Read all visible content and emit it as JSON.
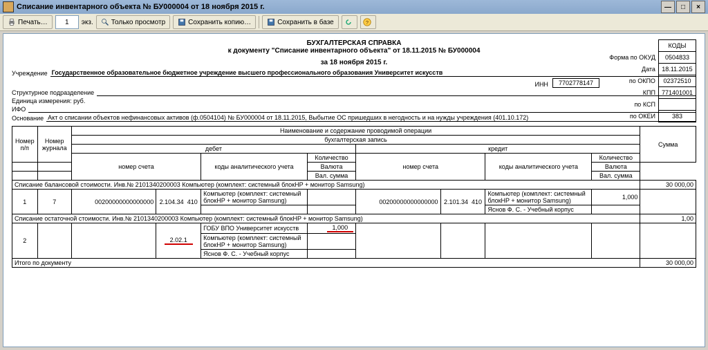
{
  "window": {
    "title": "Списание инвентарного объекта № БУ000004 от 18 ноября 2015 г."
  },
  "toolbar": {
    "print": "Печать…",
    "copies": "1",
    "copies_unit": "экз.",
    "preview": "Только просмотр",
    "save_copy": "Сохранить копию…",
    "save_db": "Сохранить в базе"
  },
  "doc": {
    "title1": "БУХГАЛТЕРСКАЯ СПРАВКА",
    "title2": "к документу \"Списание инвентарного объекта\" от 18.11.2015 № БУ000004",
    "date_line": "за 18 ноября 2015 г.",
    "org_lbl": "Учреждение",
    "org": "Государственное образовательное бюджетное учреждение высшего профессионального образования  Университет искусств",
    "inn_lbl": "ИНН",
    "inn": "7702778147",
    "struct_lbl": "Структурное подразделение",
    "unit_lbl": "Единица измерения: руб.",
    "ifo_lbl": "ИФО",
    "basis_lbl": "Основание",
    "basis": "Акт о списании объектов нефинансовых активов (ф.0504104) № БУ000004 от 18.11.2015, Выбытие ОС пришедших в негодность и на нужды учреждения (401.10.172)"
  },
  "codes": {
    "hdr": "КОДЫ",
    "okud_lbl": "Форма  по ОКУД",
    "okud": "0504833",
    "date_lbl": "Дата",
    "date": "18.11.2015",
    "okpo_lbl": "по ОКПО",
    "okpo": "02372510",
    "kpp_lbl": "КПП",
    "kpp": "771401001",
    "ksp_lbl": "по КСП",
    "ksp": "",
    "okei_lbl": "по ОКЕИ",
    "okei": "383"
  },
  "th": {
    "num_pp": "Номер п/п",
    "num_j": "Номер журнала",
    "op_name": "Наименование и содержание проводимой операции",
    "entry": "бухгалтерская запись",
    "debit": "дебет",
    "credit": "кредит",
    "acct": "номер счета",
    "analytics": "коды аналитического учета",
    "qty": "Количество",
    "curr": "Валюта",
    "val_sum": "Вал. сумма",
    "sum": "Сумма"
  },
  "sec1": {
    "title": "Списание балансовой стоимости. Инв.№ 2101340200003 Компьютер (комплект: системный блокHP + монитор Samsung)",
    "sum": "30 000,00",
    "n": "1",
    "j": "7",
    "d_code": "00200000000000000",
    "d_acct": "2.104.34",
    "d_sub": "410",
    "d_an1": "Компьютер (комплект: системный блокHP + монитор Samsung)",
    "c_code": "00200000000000000",
    "c_acct": "2.101.34",
    "c_sub": "410",
    "c_an1": "Компьютер (комплект: системный блокHP + монитор Samsung)",
    "c_an2": "Яснов Ф. С. - Учебный корпус",
    "c_qty": "1,000"
  },
  "sec2": {
    "title": "Списание остаточной стоимости. Инв.№ 2101340200003 Компьютер (комплект: системный блокHP + монитор Samsung)",
    "sum": "1,00",
    "n": "2",
    "d_acct": "2.02.1",
    "d_an1": "ГОБУ ВПО Университет искусств",
    "d_an2": "Компьютер (комплект: системный блокHP + монитор Samsung)",
    "d_an3": "Яснов Ф. С. - Учебный корпус",
    "d_qty": "1,000"
  },
  "footer": {
    "total_lbl": "Итого по документу",
    "total": "30 000,00"
  }
}
